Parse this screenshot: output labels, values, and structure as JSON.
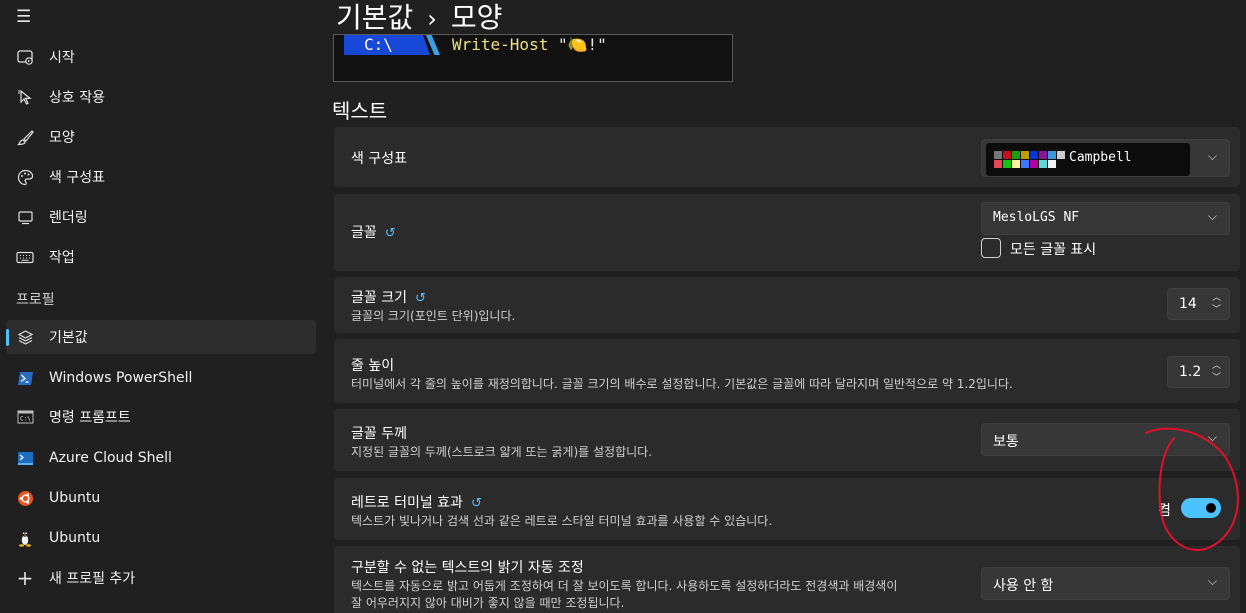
{
  "sidebar": {
    "menu_icon": "hamburger-icon",
    "items": [
      {
        "label": "시작",
        "icon": "startup-icon"
      },
      {
        "label": "상호 작용",
        "icon": "pointer-icon"
      },
      {
        "label": "모양",
        "icon": "brush-icon"
      },
      {
        "label": "색 구성표",
        "icon": "palette-icon"
      },
      {
        "label": "렌더링",
        "icon": "monitor-icon"
      },
      {
        "label": "작업",
        "icon": "keyboard-icon"
      }
    ],
    "profiles_header": "프로필",
    "profiles": [
      {
        "label": "기본값",
        "icon": "layers-icon",
        "selected": true
      },
      {
        "label": "Windows PowerShell",
        "icon": "powershell-icon"
      },
      {
        "label": "명령 프롬프트",
        "icon": "cmd-icon"
      },
      {
        "label": "Azure Cloud Shell",
        "icon": "azure-icon"
      },
      {
        "label": "Ubuntu",
        "icon": "ubuntu-icon"
      },
      {
        "label": "Ubuntu",
        "icon": "linux-penguin-icon"
      },
      {
        "label": "새 프로필 추가",
        "icon": "plus-icon"
      }
    ]
  },
  "header": {
    "crumb_1": "기본값",
    "separator": "›",
    "crumb_2": "모양"
  },
  "preview": {
    "prompt": "C:\\",
    "command": "Write-Host",
    "argument": "\"🍋!\""
  },
  "section_title": "텍스트",
  "settings": {
    "color_scheme": {
      "title": "색 구성표",
      "value": "Campbell"
    },
    "font": {
      "title": "글꼴",
      "value": "MesloLGS NF",
      "show_all_label": "모든 글꼴 표시"
    },
    "font_size": {
      "title": "글꼴 크기",
      "desc": "글꼴의 크기(포인트 단위)입니다.",
      "value": "14"
    },
    "line_height": {
      "title": "줄 높이",
      "desc": "터미널에서 각 줄의 높이를 재정의합니다. 글꼴 크기의 배수로 설정합니다. 기본값은 글꼴에 따라 달라지며 일반적으로 약 1.2입니다.",
      "value": "1.2"
    },
    "font_weight": {
      "title": "글꼴 두께",
      "desc": "지정된 글꼴의 두께(스트로크 얇게 또는 굵게)를 설정합니다.",
      "value": "보통"
    },
    "retro": {
      "title": "레트로 터미널 효과",
      "desc": "텍스트가 빛나거나 검색 선과 같은 레트로 스타일 터미널 효과를 사용할 수 있습니다.",
      "toggle_label": "켬",
      "enabled": true
    },
    "brightness": {
      "title": "구분할 수 없는 텍스트의 밝기 자동 조정",
      "desc_1": "텍스트를 자동으로 밝고 어둡게 조정하여 더 잘 보이도록 합니다. 사용하도록 설정하더라도 전경색과 배경색이",
      "desc_2": "잘 어우러지지 않아 대비가 좋지 않을 때만 조정됩니다.",
      "value": "사용 안 함"
    }
  },
  "colors": {
    "accent": "#4cc2ff",
    "annotation": "#e0102a",
    "scheme_swatches": [
      "#767676",
      "#c50f1f",
      "#13a10e",
      "#c19c00",
      "#0037da",
      "#881798",
      "#3a96dd",
      "#cccccc",
      "#e74856",
      "#16c60c",
      "#f9f1a5",
      "#3b78ff",
      "#b4009e",
      "#61d6d6",
      "#f2f2f2",
      "#0c0c0c"
    ]
  }
}
